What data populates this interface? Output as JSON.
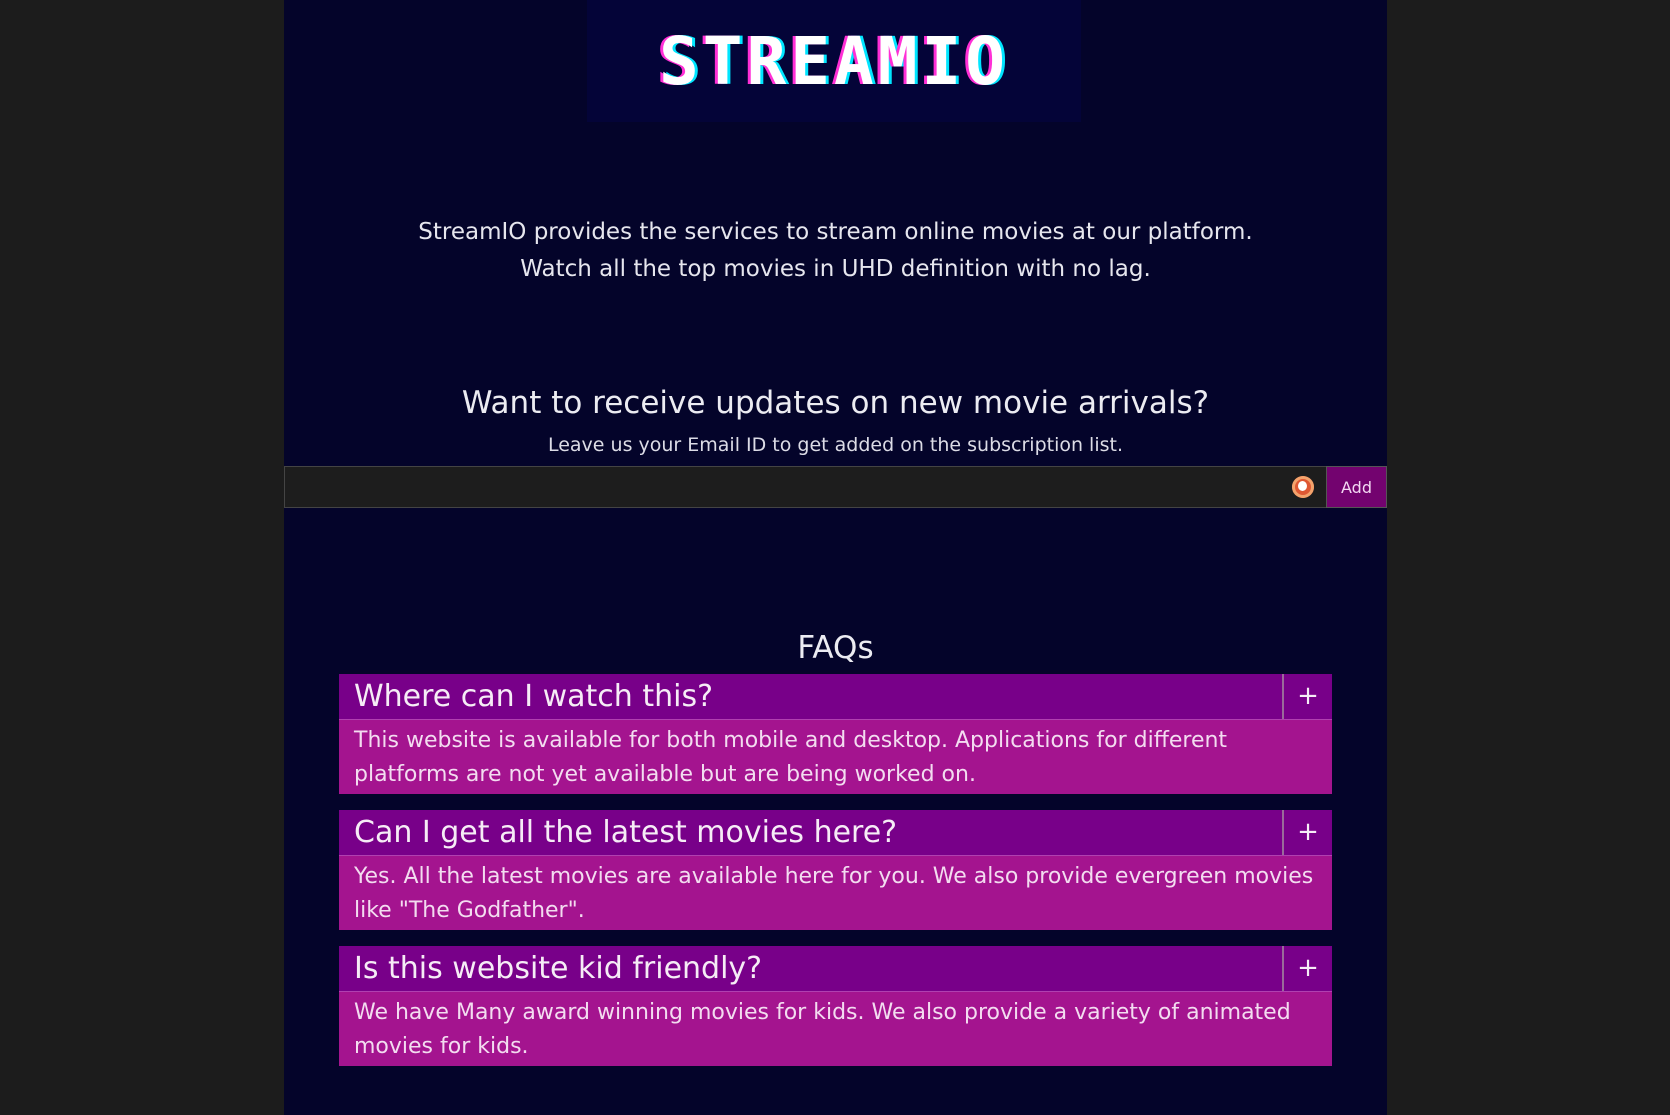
{
  "brand": {
    "logo_text": "STREAMIO"
  },
  "intro": {
    "line1": "StreamIO provides the services to stream online movies at our platform.",
    "line2": "Watch all the top movies in UHD definition with no lag."
  },
  "subscribe": {
    "title": "Want to receive updates on new movie arrivals?",
    "subtitle": "Leave us your Email ID to get added on the subscription list.",
    "email_value": "",
    "button_label": "Add"
  },
  "faq": {
    "title": "FAQs",
    "items": [
      {
        "question": "Where can I watch this?",
        "toggle": "+",
        "answer": "This website is available for both mobile and desktop. Applications for different platforms are not yet available but are being worked on."
      },
      {
        "question": "Can I get all the latest movies here?",
        "toggle": "+",
        "answer": "Yes. All the latest movies are available here for you. We also provide evergreen movies like \"The Godfather\"."
      },
      {
        "question": "Is this website kid friendly?",
        "toggle": "+",
        "answer": "We have Many award winning movies for kids. We also provide a variety of animated movies for kids."
      }
    ]
  },
  "colors": {
    "page_bg": "#04042a",
    "outer_bg": "#1c1c1c",
    "faq_header": "#780089",
    "faq_answer": "#a4148f",
    "add_button": "#73036f"
  },
  "icons": {
    "email_autofill": "duckduckgo-icon"
  }
}
